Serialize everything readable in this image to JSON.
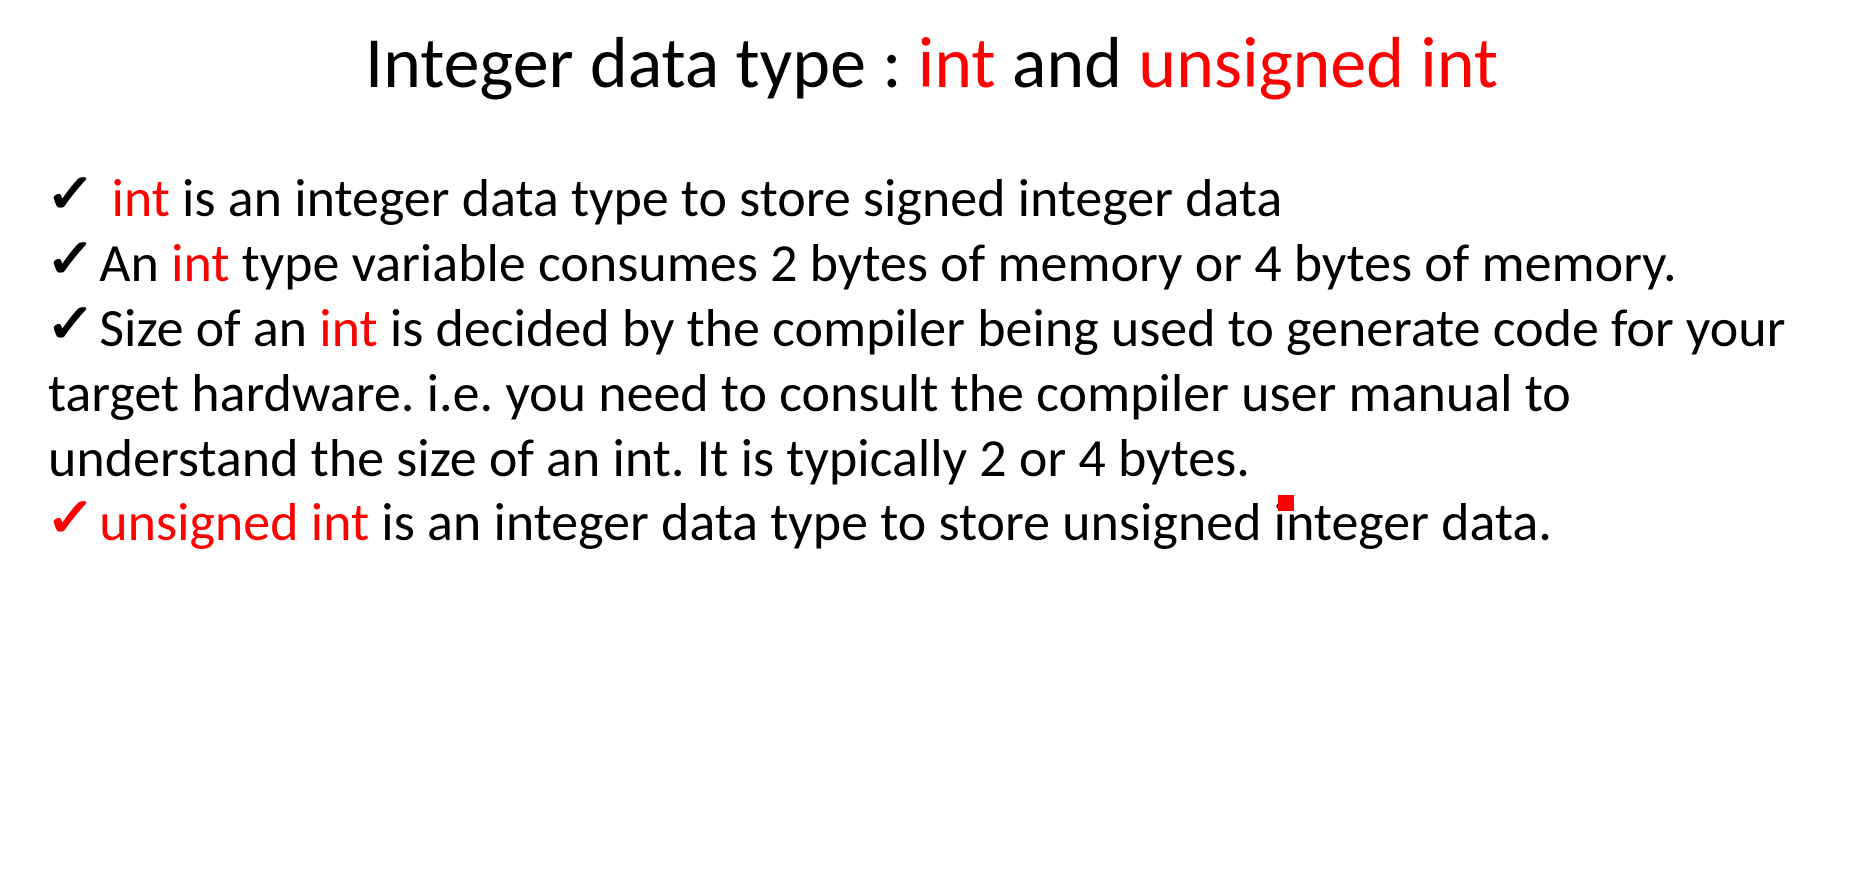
{
  "title": {
    "part1": "Integer data type : ",
    "part2_red": "int",
    "part3": " and ",
    "part4_red": "unsigned int"
  },
  "bullets": {
    "b1": {
      "lead_space": " ",
      "red": "int",
      "rest": " is an integer data type to store signed integer data"
    },
    "b2": {
      "pre": "An ",
      "red": "int",
      "rest": " type variable consumes 2 bytes of memory or 4 bytes of memory."
    },
    "b3": {
      "pre": "Size of an ",
      "red": "int",
      "rest": " is decided by the compiler being used to generate code for your target hardware. i.e. you need to consult the compiler user manual to understand the size of an int. It is typically 2 or 4 bytes."
    },
    "b4": {
      "red": "unsigned int",
      "rest": " is an integer data type to store unsigned integer data."
    }
  },
  "checkmark": "✓"
}
